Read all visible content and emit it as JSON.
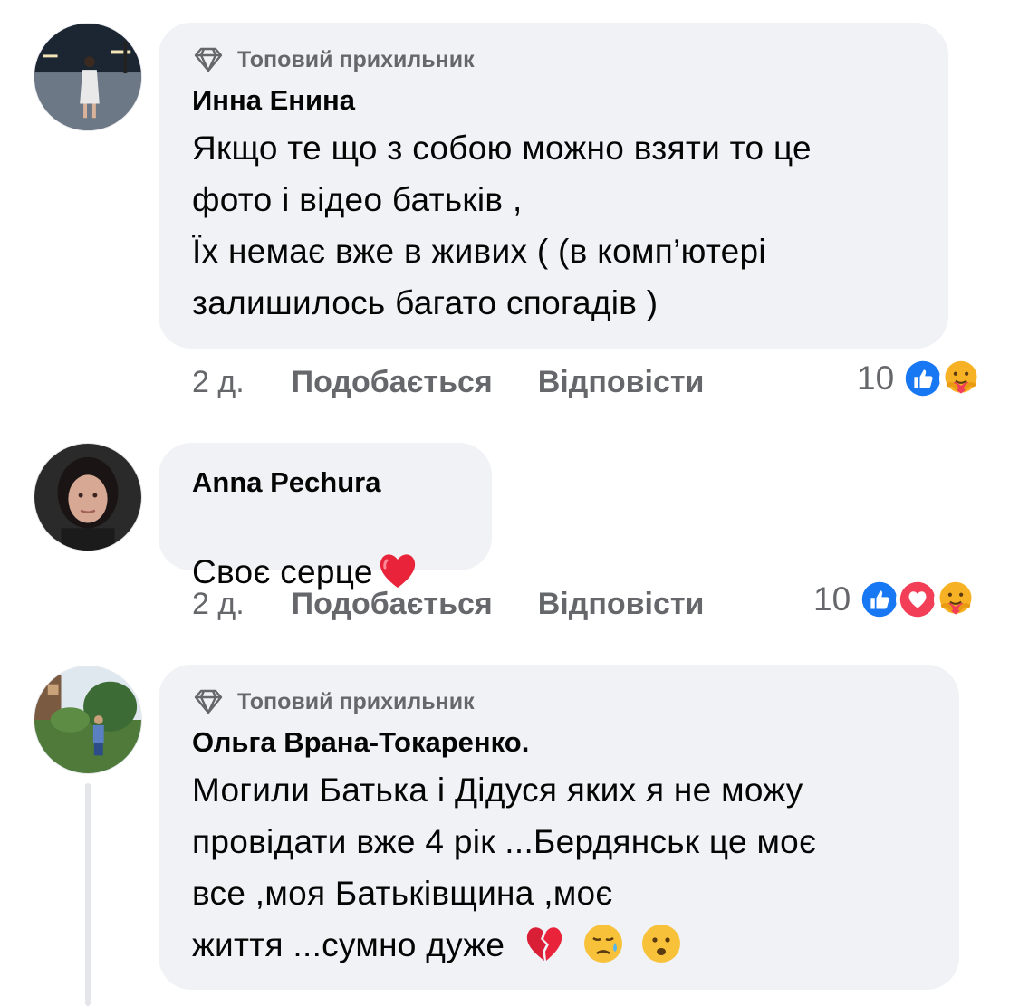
{
  "comments": [
    {
      "badge": "Топовий прихильник",
      "author": "Инна Енина",
      "text": "Якщо те що з собою можно взяти то це\nфото і відео батьків ,\nЇх немає вже в живих ( (в комп’ютері\nзалишилось багато спогадів  )",
      "time": "2 д.",
      "like_label": "Подобається",
      "reply_label": "Відповісти",
      "reaction_count": "10",
      "reactions": [
        "like-icon",
        "care-icon"
      ]
    },
    {
      "author": "Anna Pechura",
      "text": "Своє серце",
      "time": "2 д.",
      "like_label": "Подобається",
      "reply_label": "Відповісти",
      "reaction_count": "10",
      "reactions": [
        "like-icon",
        "love-icon",
        "care-icon"
      ]
    },
    {
      "badge": "Топовий прихильник",
      "author": "Ольга Врана-Токаренко.",
      "text_lines": [
        "Могили Батька і Дідуся яких я не можу",
        "провідати вже 4 рік ...Бердянськ це моє",
        "все ,моя Батьківщина ,моє",
        "життя ...сумно дуже"
      ]
    }
  ],
  "colors": {
    "bubble": "#f0f2f5",
    "secondary_text": "#65676b",
    "primary_text": "#050505",
    "like_blue": "#1877f2",
    "love_red": "#f33e58"
  }
}
